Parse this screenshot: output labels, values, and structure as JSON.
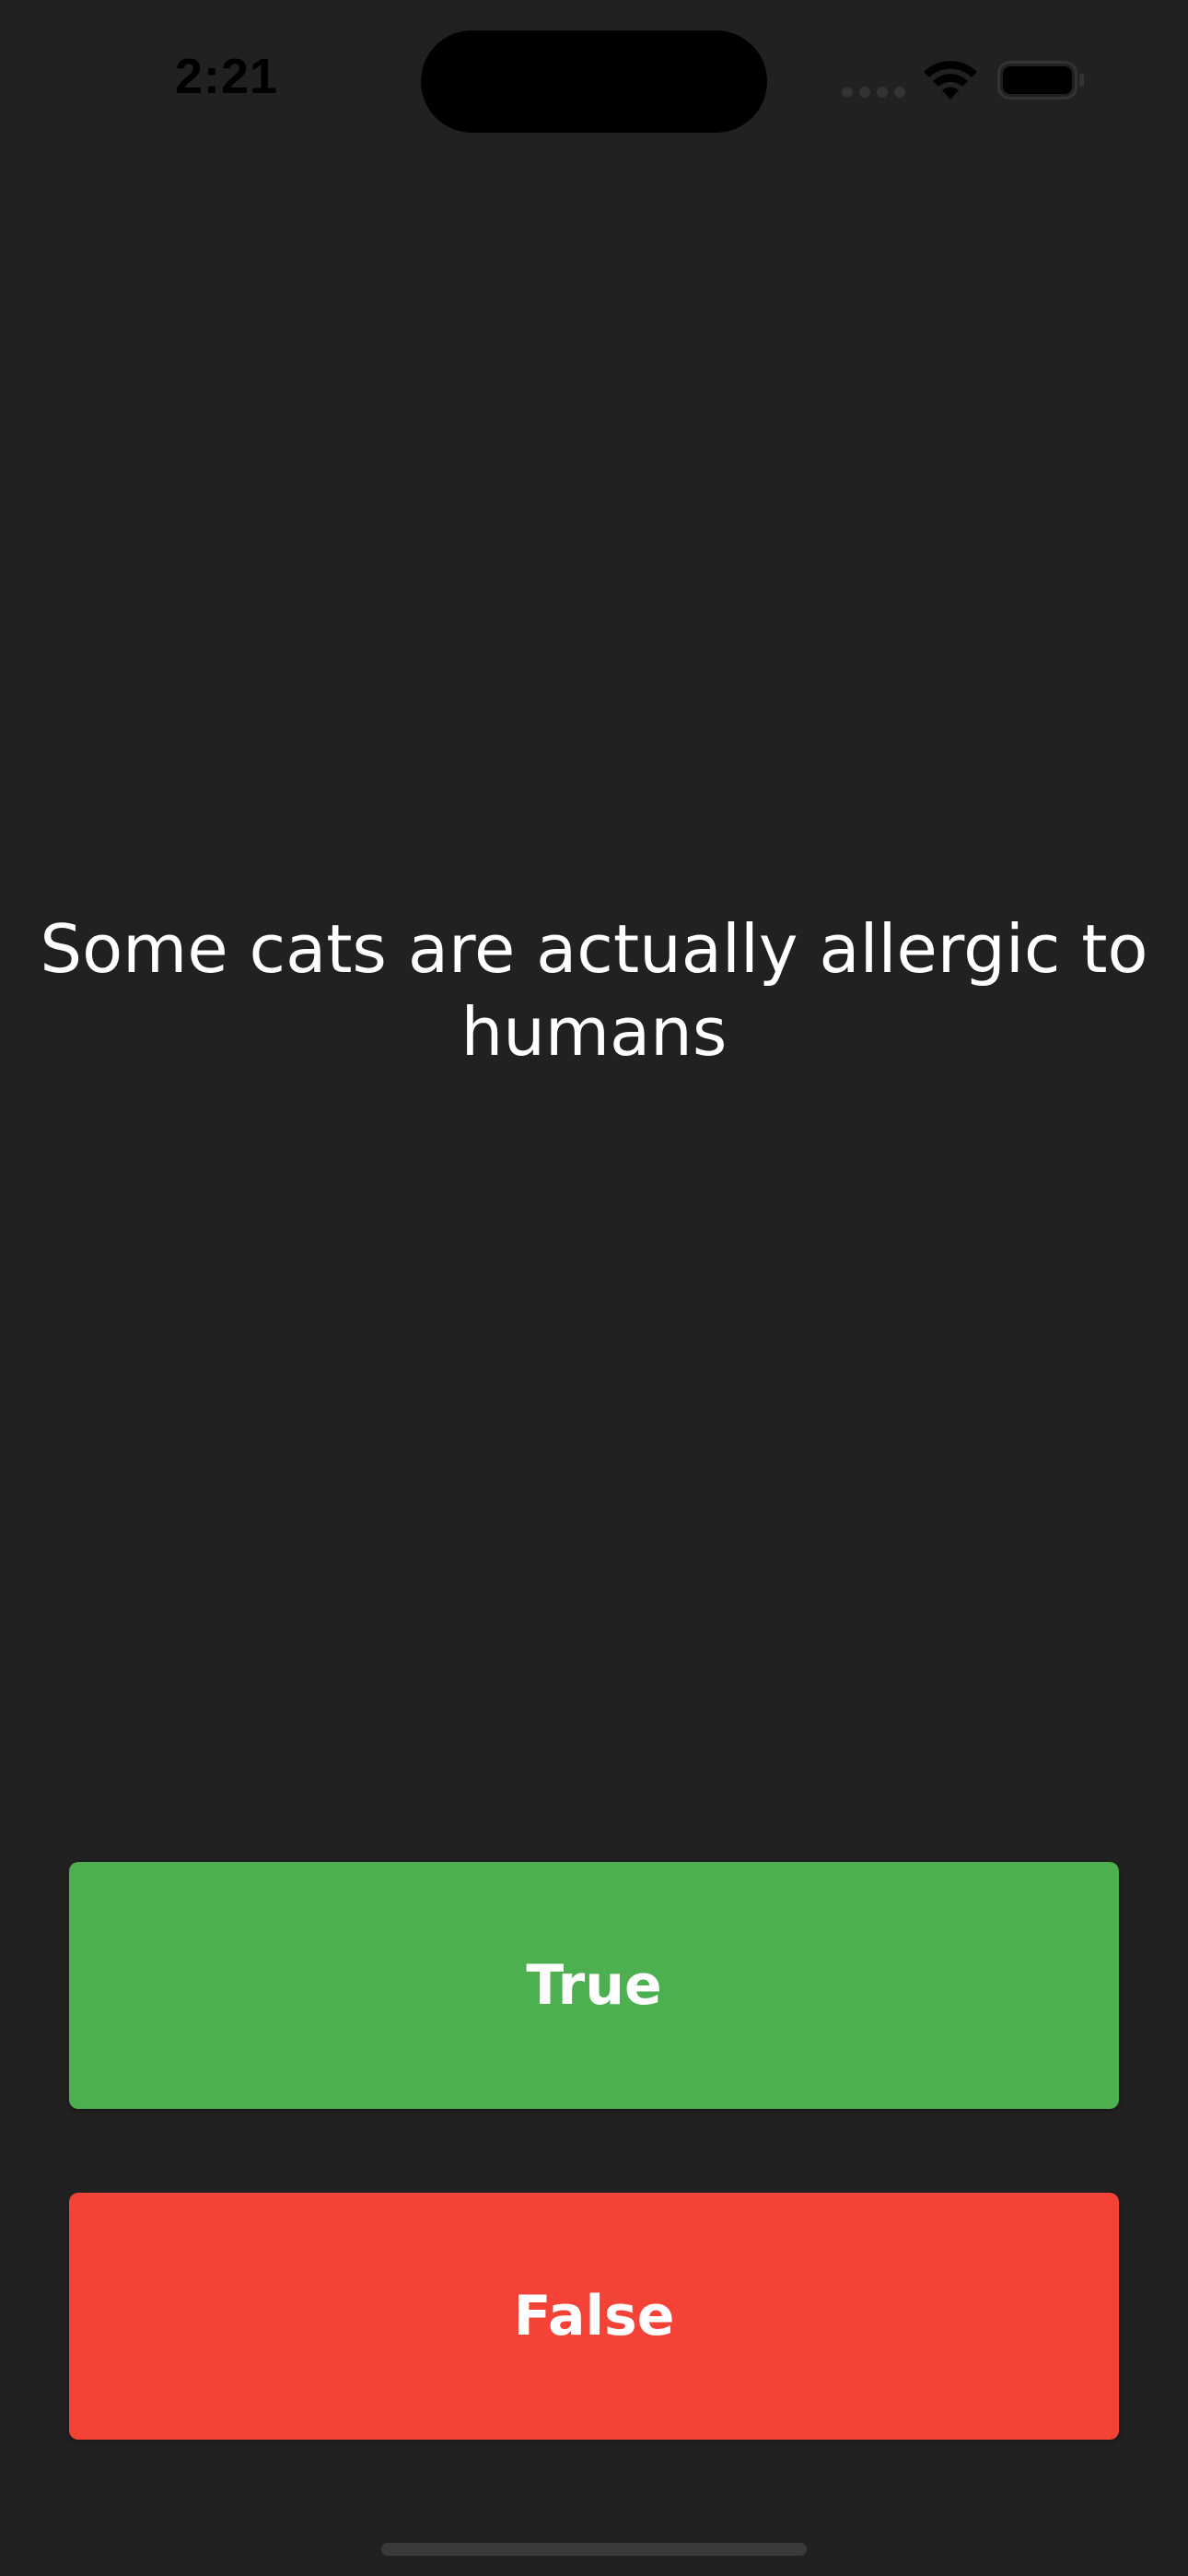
{
  "status_bar": {
    "time": "2:21",
    "icons": [
      "cellular-signal-icon",
      "wifi-icon",
      "battery-icon"
    ]
  },
  "quiz": {
    "question": "Some cats are actually allergic to humans"
  },
  "buttons": {
    "true_label": "True",
    "false_label": "False"
  },
  "colors": {
    "background": "#212121",
    "true_button": "#4caf50",
    "false_button": "#f44336",
    "text": "#ffffff"
  }
}
